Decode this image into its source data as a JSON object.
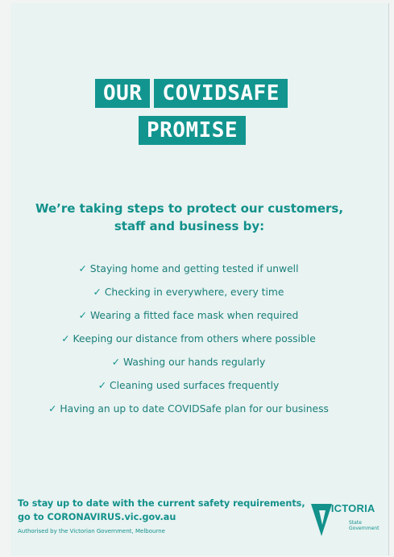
{
  "title": {
    "word1": "OUR",
    "word2": "COVIDSAFE",
    "word3": "PROMISE"
  },
  "intro": {
    "line1": "We’re taking steps to protect our customers,",
    "line2": "staff and business by:"
  },
  "checkmark": "✓",
  "items": [
    "Staying home and getting tested if unwell",
    "Checking in everywhere, every time",
    "Wearing a fitted face mask when required",
    "Keeping our distance from others where possible",
    "Washing our hands regularly",
    "Cleaning used surfaces frequently",
    "Having an up to date COVIDSafe plan for our business"
  ],
  "footer": {
    "line1": "To stay up to date with the current safety requirements,",
    "line2": "go to CORONAVIRUS.vic.gov.au",
    "authorised": "Authorised by the Victorian Government, Melbourne"
  },
  "logo": {
    "word": "VICTORIA",
    "sub1": "State",
    "sub2": "Government"
  },
  "colors": {
    "teal": "#12958f",
    "background": "#e8f3f2"
  }
}
